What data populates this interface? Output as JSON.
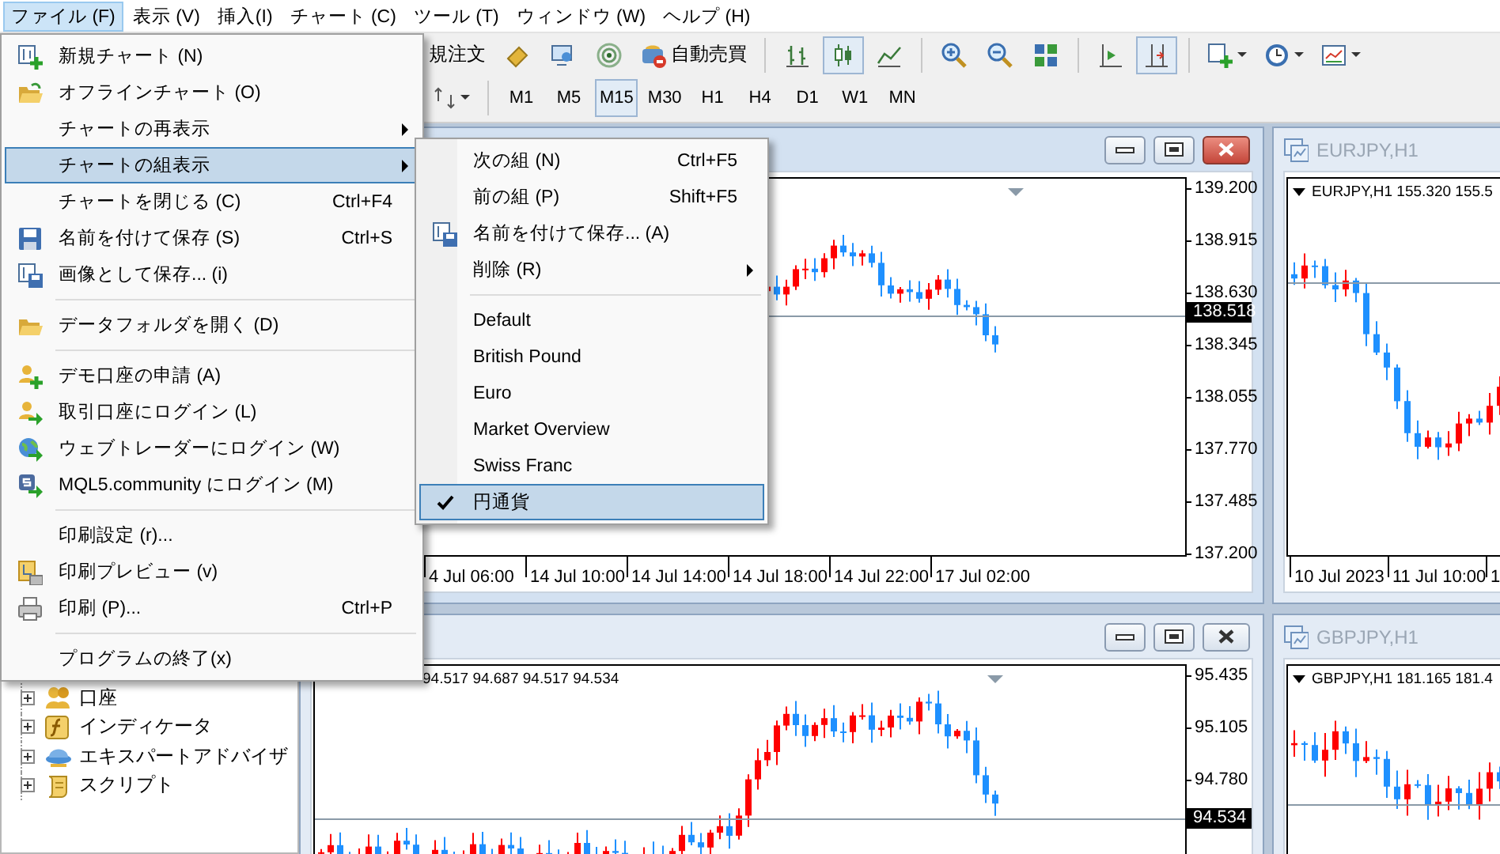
{
  "menu_bar": [
    {
      "label": "ファイル (F)",
      "selected": true
    },
    {
      "label": "表示 (V)",
      "selected": false
    },
    {
      "label": "挿入(I)",
      "selected": false
    },
    {
      "label": "チャート (C)",
      "selected": false
    },
    {
      "label": "ツール (T)",
      "selected": false
    },
    {
      "label": "ウィンドウ (W)",
      "selected": false
    },
    {
      "label": "ヘルプ (H)",
      "selected": false
    }
  ],
  "toolbar": {
    "new_order": "規注文",
    "auto_trading": "自動売買",
    "timeframes": [
      {
        "label": "M1",
        "selected": false
      },
      {
        "label": "M5",
        "selected": false
      },
      {
        "label": "M15",
        "selected": true
      },
      {
        "label": "M30",
        "selected": false
      },
      {
        "label": "H1",
        "selected": false
      },
      {
        "label": "H4",
        "selected": false
      },
      {
        "label": "D1",
        "selected": false
      },
      {
        "label": "W1",
        "selected": false
      },
      {
        "label": "MN",
        "selected": false
      }
    ]
  },
  "navigator": {
    "items": [
      {
        "label": "口座",
        "expanded": false
      },
      {
        "label": "インディケータ",
        "expanded": false
      },
      {
        "label": "エキスパートアドバイザ",
        "expanded": false
      },
      {
        "label": "スクリプト",
        "expanded": false
      }
    ]
  },
  "charts": [
    {
      "active": true,
      "price_ticks": [
        "139.200",
        "138.915",
        "138.630",
        "138.345",
        "138.055",
        "137.770",
        "137.485",
        "137.200"
      ],
      "current_price": "138.518",
      "time_labels": [
        "4 Jul 06:00",
        "14 Jul 10:00",
        "14 Jul 14:00",
        "14 Jul 18:00",
        "14 Jul 22:00",
        "17 Jul 02:00"
      ]
    },
    {
      "title": "EURJPY,H1",
      "active": false,
      "header": "EURJPY,H1 155.320 155.5",
      "time_labels": [
        "10 Jul 2023",
        "11 Jul 10:00",
        "1"
      ]
    },
    {
      "active": false,
      "header": "94.517 94.687 94.517 94.534",
      "price_ticks": [
        "95.435",
        "95.105",
        "94.780"
      ],
      "current_price": "94.534"
    },
    {
      "title": "GBPJPY,H1",
      "active": false,
      "header": "GBPJPY,H1 181.165 181.4"
    }
  ],
  "file_menu": [
    {
      "kind": "item",
      "label": "新規チャート (N)",
      "selected": false
    },
    {
      "kind": "item",
      "label": "オフラインチャート (O)",
      "selected": false
    },
    {
      "kind": "item",
      "label": "チャートの再表示",
      "submenu": true,
      "selected": false
    },
    {
      "kind": "item",
      "label": "チャートの組表示",
      "submenu": true,
      "selected": true
    },
    {
      "kind": "item",
      "label": "チャートを閉じる (C)",
      "shortcut": "Ctrl+F4",
      "selected": false
    },
    {
      "kind": "item",
      "label": "名前を付けて保存 (S)",
      "shortcut": "Ctrl+S",
      "selected": false
    },
    {
      "kind": "item",
      "label": "画像として保存... (i)",
      "selected": false
    },
    {
      "kind": "separator"
    },
    {
      "kind": "item",
      "label": "データフォルダを開く (D)",
      "selected": false
    },
    {
      "kind": "separator"
    },
    {
      "kind": "item",
      "label": "デモ口座の申請 (A)",
      "selected": false
    },
    {
      "kind": "item",
      "label": "取引口座にログイン (L)",
      "selected": false
    },
    {
      "kind": "item",
      "label": "ウェブトレーダーにログイン (W)",
      "selected": false
    },
    {
      "kind": "item",
      "label": "MQL5.community にログイン (M)",
      "selected": false
    },
    {
      "kind": "separator"
    },
    {
      "kind": "item",
      "label": "印刷設定 (r)...",
      "selected": false
    },
    {
      "kind": "item",
      "label": "印刷プレビュー (v)",
      "selected": false
    },
    {
      "kind": "item",
      "label": "印刷 (P)...",
      "shortcut": "Ctrl+P",
      "selected": false
    },
    {
      "kind": "separator"
    },
    {
      "kind": "item",
      "label": "プログラムの終了(x)",
      "selected": false
    }
  ],
  "group_submenu": [
    {
      "kind": "item",
      "label": "次の組 (N)",
      "shortcut": "Ctrl+F5",
      "selected": false
    },
    {
      "kind": "item",
      "label": "前の組 (P)",
      "shortcut": "Shift+F5",
      "selected": false
    },
    {
      "kind": "item",
      "label": "名前を付けて保存... (A)",
      "selected": false
    },
    {
      "kind": "item",
      "label": "削除 (R)",
      "submenu": true,
      "selected": false
    },
    {
      "kind": "separator"
    },
    {
      "kind": "item",
      "label": "Default",
      "checked": false,
      "selected": false
    },
    {
      "kind": "item",
      "label": "British Pound",
      "checked": false,
      "selected": false
    },
    {
      "kind": "item",
      "label": "Euro",
      "checked": false,
      "selected": false
    },
    {
      "kind": "item",
      "label": "Market Overview",
      "checked": false,
      "selected": false
    },
    {
      "kind": "item",
      "label": "Swiss Franc",
      "checked": false,
      "selected": false
    },
    {
      "kind": "item",
      "label": "円通貨",
      "checked": true,
      "selected": true
    }
  ]
}
